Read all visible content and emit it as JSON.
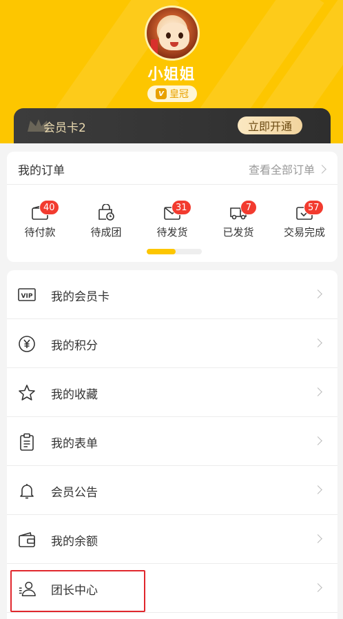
{
  "header": {
    "username": "小姐姐",
    "level_icon": "V",
    "level_label": "皇冠",
    "bg_color": "#FDC600"
  },
  "member_card": {
    "title": "会员卡2",
    "open_button": "立即开通"
  },
  "orders": {
    "title": "我的订单",
    "view_all": "查看全部订单",
    "items": [
      {
        "label": "待付款",
        "badge": "40",
        "icon": "wallet-icon"
      },
      {
        "label": "待成团",
        "badge": "",
        "icon": "bag-clock-icon"
      },
      {
        "label": "待发货",
        "badge": "31",
        "icon": "box-icon"
      },
      {
        "label": "已发货",
        "badge": "7",
        "icon": "truck-icon"
      },
      {
        "label": "交易完成",
        "badge": "57",
        "icon": "box-check-icon"
      }
    ],
    "scroll_progress": 0.52
  },
  "menu": {
    "items": [
      {
        "label": "我的会员卡",
        "icon": "vip-icon"
      },
      {
        "label": "我的积分",
        "icon": "yen-coin-icon"
      },
      {
        "label": "我的收藏",
        "icon": "star-icon"
      },
      {
        "label": "我的表单",
        "icon": "clipboard-icon"
      },
      {
        "label": "会员公告",
        "icon": "bell-icon"
      },
      {
        "label": "我的余额",
        "icon": "wallet-balance-icon"
      },
      {
        "label": "团长中心",
        "icon": "group-leader-icon"
      }
    ]
  },
  "colors": {
    "accent": "#FDC600",
    "badge": "#F23B2F",
    "highlight": "#E0262C"
  }
}
